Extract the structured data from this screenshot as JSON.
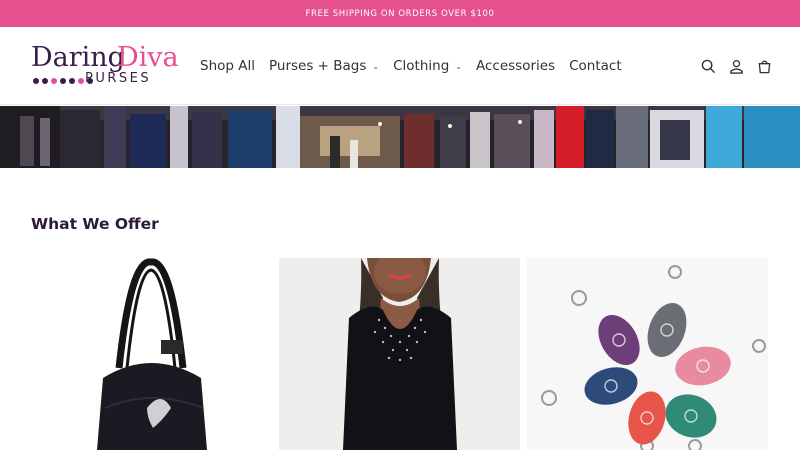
{
  "announcement": "FREE SHIPPING ON ORDERS OVER $100",
  "logo": {
    "word1": "Daring",
    "word2": "Diva",
    "word3": "PURSES"
  },
  "nav": [
    {
      "label": "Shop All",
      "dropdown": false
    },
    {
      "label": "Purses + Bags",
      "dropdown": true
    },
    {
      "label": "Clothing",
      "dropdown": true
    },
    {
      "label": "Accessories",
      "dropdown": false
    },
    {
      "label": "Contact",
      "dropdown": false
    }
  ],
  "header_icons": [
    "search-icon",
    "account-icon",
    "cart-icon"
  ],
  "section": {
    "title": "What We Offer"
  },
  "cards": [
    "black-purse-image",
    "black-dress-image",
    "keychain-alarms-image"
  ],
  "colors": {
    "brand_pink": "#e5508e",
    "brand_purple": "#3a1d4a"
  }
}
